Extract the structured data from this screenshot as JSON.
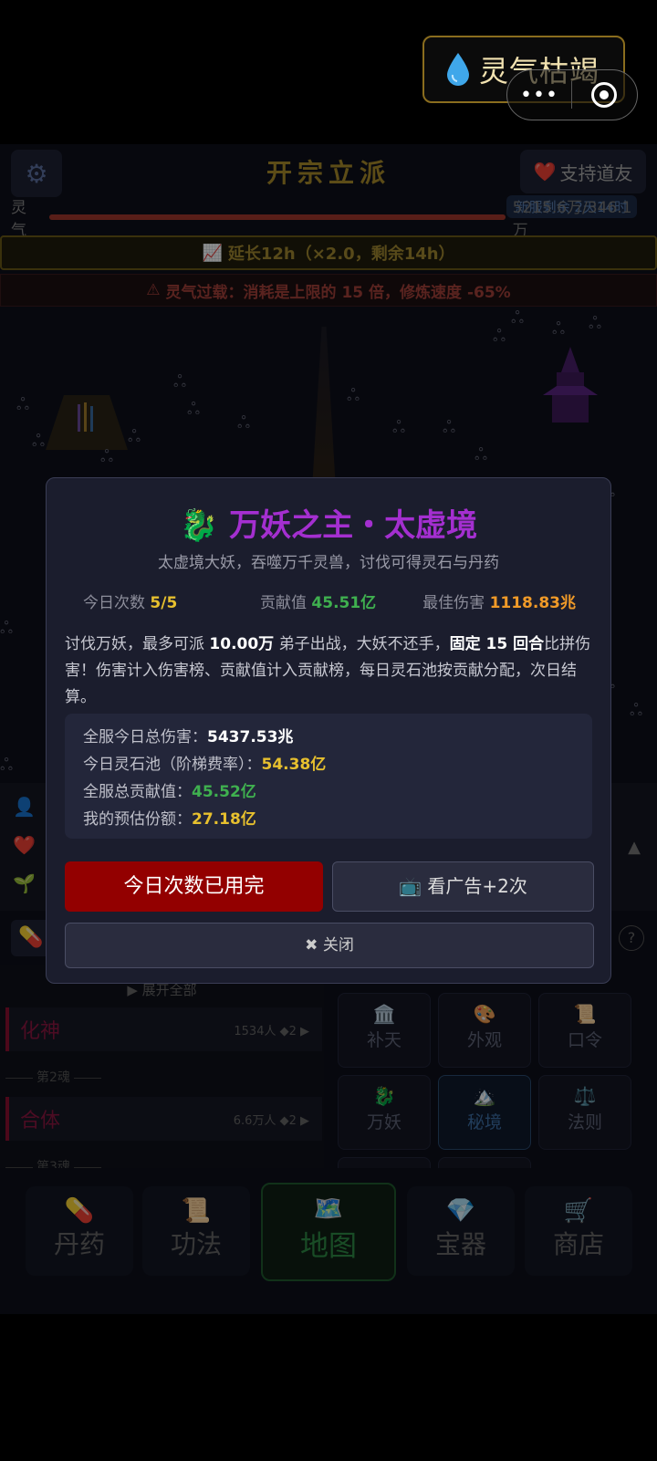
{
  "status_toast": {
    "text": "灵气枯竭",
    "icon": "water-drop-icon"
  },
  "capsule": {
    "more": "•••"
  },
  "header": {
    "title": "开宗立派",
    "support_label": "支持道友",
    "expire_badge": "新服剩余 2天14时",
    "qi_label": "灵气",
    "qi_value": "5215.6万/346.1万",
    "qi_fraction": 1.0
  },
  "boost_bar": {
    "icon": "📈",
    "text": "延长12h（×2.0，剩余14h）"
  },
  "warning_bar": {
    "icon": "⚠",
    "text": "灵气过载：消耗是上限的 15 倍，修炼速度 -65%"
  },
  "left_list": {
    "expand_label": "▶ 展开全部",
    "realms": [
      {
        "name": "化神",
        "count": "1534人 ◆2 ▶"
      },
      {
        "name": "合体",
        "count": "6.6万人 ◆2 ▶"
      }
    ],
    "soul_labels": [
      "第2魂",
      "第3魂"
    ]
  },
  "grid_buttons": [
    {
      "icon": "🏛️",
      "label": "补天"
    },
    {
      "icon": "🎨",
      "label": "外观"
    },
    {
      "icon": "📜",
      "label": "口令"
    },
    {
      "icon": "🐉",
      "label": "万妖"
    },
    {
      "icon": "🏔️",
      "label": "秘境"
    },
    {
      "icon": "⚖️",
      "label": "法则"
    },
    {
      "icon": "🐾",
      "label": ""
    },
    {
      "icon": "📢",
      "label": ""
    }
  ],
  "tabs": [
    {
      "icon": "💊",
      "label": "丹药"
    },
    {
      "icon": "📜",
      "label": "功法"
    },
    {
      "icon": "🗺️",
      "label": "地图"
    },
    {
      "icon": "💎",
      "label": "宝器"
    },
    {
      "icon": "🛒",
      "label": "商店"
    }
  ],
  "modal": {
    "title_icon": "🐉",
    "title": "万妖之主・太虚境",
    "subtitle": "太虚境大妖，吞噬万千灵兽，讨伐可得灵石与丹药",
    "stats": {
      "count_label": "今日次数",
      "count_value": "5/5",
      "contrib_label": "贡献值",
      "contrib_value": "45.51亿",
      "best_label": "最佳伤害",
      "best_value": "1118.83兆"
    },
    "desc": {
      "p1": "讨伐万妖，最多可派 ",
      "b1": "10.00万",
      "p2": " 弟子出战，大妖不还手，",
      "b2": "固定 15 回合",
      "p3": "比拼伤害！伤害计入伤害榜、贡献值计入贡献榜，每日灵石池按贡献分配，次日结算。"
    },
    "summary": [
      {
        "label": "全服今日总伤害：",
        "value": "5437.53兆",
        "tone": "w"
      },
      {
        "label": "今日灵石池（阶梯费率）：",
        "value": "54.38亿",
        "tone": "yel"
      },
      {
        "label": "全服总贡献值：",
        "value": "45.52亿",
        "tone": "grn"
      },
      {
        "label": "我的预估份额：",
        "value": "27.18亿",
        "tone": "yel"
      }
    ],
    "btn_used": "今日次数已用完",
    "btn_ad_icon": "📺",
    "btn_ad": "看广告+2次",
    "btn_close_icon": "✖",
    "btn_close": "关闭"
  }
}
